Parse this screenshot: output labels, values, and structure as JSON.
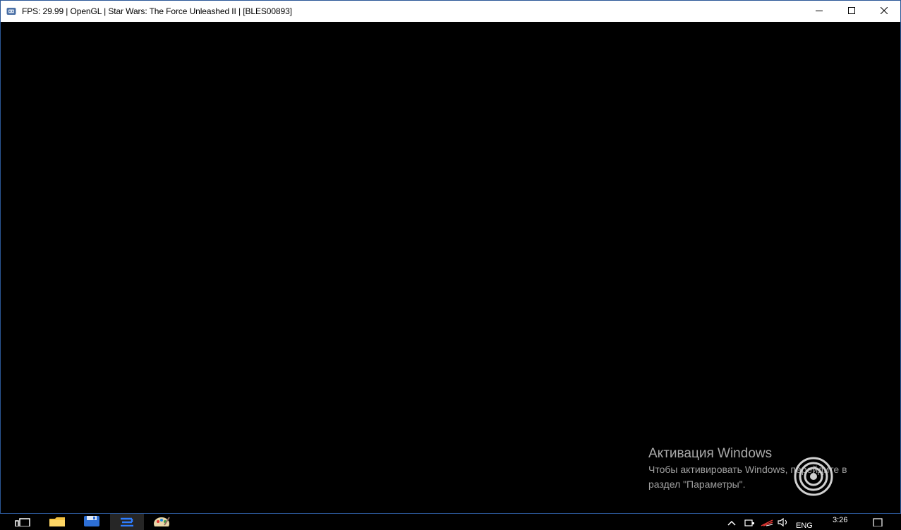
{
  "window": {
    "title": "FPS: 29.99 | OpenGL | Star Wars: The Force Unleashed II | [BLES00893]",
    "icon": "rpcs3-app-icon",
    "controls": {
      "minimize": "minimize-icon",
      "maximize": "maximize-icon",
      "close": "close-icon"
    }
  },
  "watermark": {
    "title": "Активация Windows",
    "line1": "Чтобы активировать Windows, перейдите в",
    "line2": "раздел \"Параметры\"."
  },
  "taskbar": {
    "items": [
      "task-view-icon",
      "file-explorer-icon",
      "save-disk-icon",
      "rpcs3-icon",
      "paint-icon"
    ],
    "tray": {
      "language": "ENG",
      "time": "3:26"
    }
  },
  "colors": {
    "titlebar": "#ffffff",
    "game_background": "#000000",
    "watermark_text": "#a9a9a9",
    "active_task": "#262626",
    "window_border": "#2b5797"
  }
}
